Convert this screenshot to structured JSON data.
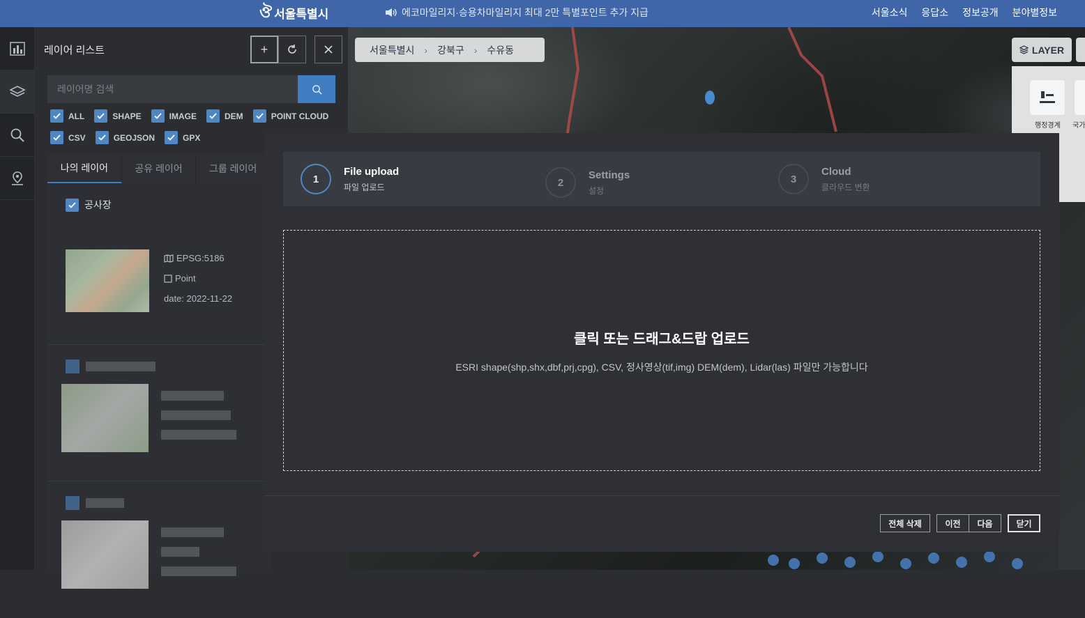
{
  "topbar": {
    "logo_text": "서울특별시",
    "notice": "에코마일리지·승용차마일리지 최대 2만 특별포인트 추가 지급",
    "nav": [
      "서울소식",
      "응답소",
      "정보공개",
      "분야별정보"
    ]
  },
  "breadcrumb": [
    "서울특별시",
    "강북구",
    "수유동"
  ],
  "panel": {
    "title": "레이어 리스트",
    "search_placeholder": "레이어명 검색",
    "filters_row1": [
      "ALL",
      "SHAPE",
      "IMAGE",
      "DEM",
      "POINT CLOUD"
    ],
    "filters_row2": [
      "CSV",
      "GEOJSON",
      "GPX"
    ],
    "tabs": [
      "나의 레이어",
      "공유 레이어",
      "그룹 레이어"
    ],
    "layer": {
      "name": "공사장",
      "epsg": "EPSG:5186",
      "geom": "Point",
      "date": "date: 2022-11-22"
    }
  },
  "modal": {
    "steps": [
      {
        "num": "1",
        "title": "File upload",
        "sub": "파일 업로드"
      },
      {
        "num": "2",
        "title": "Settings",
        "sub": "설정"
      },
      {
        "num": "3",
        "title": "Cloud",
        "sub": "클라우드 변환"
      }
    ],
    "drop_title": "클릭 또는 드래그&드랍 업로드",
    "drop_desc": "ESRI shape(shp,shx,dbf,prj,cpg), CSV, 정사영상(tif,img) DEM(dem), Lidar(las) 파일만 가능합니다",
    "buttons": {
      "delete_all": "전체 삭제",
      "prev": "이전",
      "next": "다음",
      "close": "닫기"
    }
  },
  "right": {
    "layer_button": "LAYER",
    "tiles": [
      "행정경계",
      "국가"
    ]
  },
  "colors": {
    "topbar": "#3e66a8",
    "accent": "#4f87c4",
    "modal_bg": "#2e3035"
  }
}
